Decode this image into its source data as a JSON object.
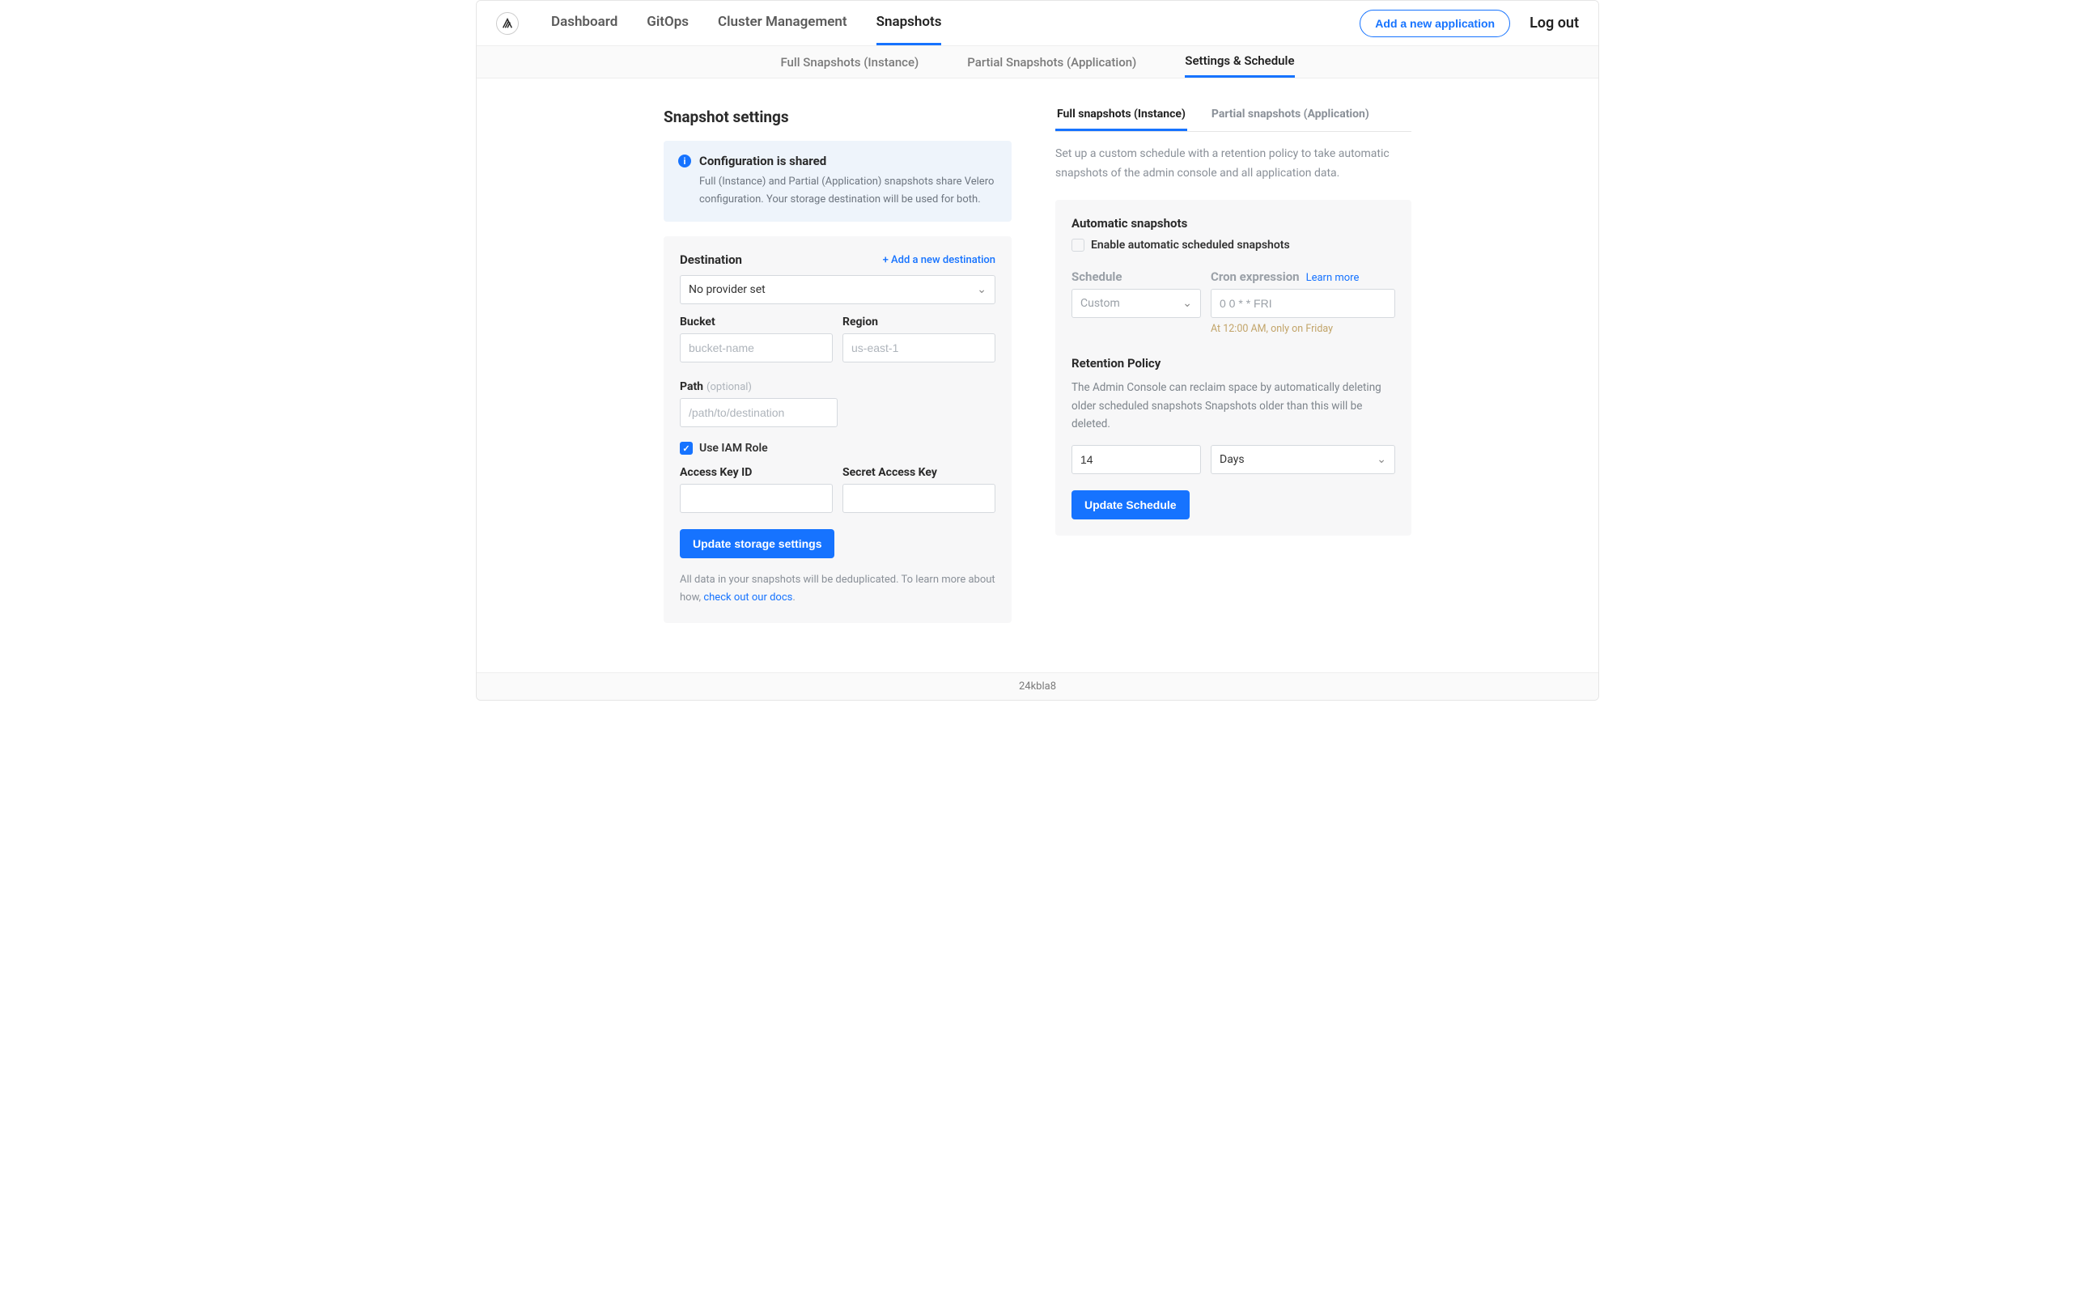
{
  "nav": {
    "items": [
      "Dashboard",
      "GitOps",
      "Cluster Management",
      "Snapshots"
    ],
    "active": 3,
    "add_app": "Add a new application",
    "logout": "Log out"
  },
  "subnav": {
    "items": [
      "Full Snapshots (Instance)",
      "Partial Snapshots (Application)",
      "Settings & Schedule"
    ],
    "active": 2
  },
  "left": {
    "title": "Snapshot settings",
    "info_title": "Configuration is shared",
    "info_body": "Full (Instance) and Partial (Application) snapshots share Velero configuration. Your storage destination will be used for both.",
    "dest_label": "Destination",
    "add_dest": "+ Add a new destination",
    "provider": "No provider set",
    "bucket_label": "Bucket",
    "bucket_ph": "bucket-name",
    "region_label": "Region",
    "region_ph": "us-east-1",
    "path_label": "Path",
    "path_opt": "(optional)",
    "path_ph": "/path/to/destination",
    "iam_label": "Use IAM Role",
    "iam_checked": true,
    "ak_label": "Access Key ID",
    "sk_label": "Secret Access Key",
    "update_btn": "Update storage settings",
    "foot_a": "All data in your snapshots will be deduplicated. To learn more about how, ",
    "foot_link": "check out our docs",
    "foot_b": "."
  },
  "right": {
    "tabs": [
      "Full snapshots (Instance)",
      "Partial snapshots (Application)"
    ],
    "active": 0,
    "desc": "Set up a custom schedule with a retention policy to take automatic snapshots of the admin console and all application data.",
    "auto_title": "Automatic snapshots",
    "auto_check": "Enable automatic scheduled snapshots",
    "auto_checked": false,
    "sched_label": "Schedule",
    "sched_value": "Custom",
    "cron_label": "Cron expression",
    "cron_learn": "Learn more",
    "cron_value": "0 0 * * FRI",
    "cron_hint": "At 12:00 AM, only on Friday",
    "ret_title": "Retention Policy",
    "ret_desc": "The Admin Console can reclaim space by automatically deleting older scheduled snapshots Snapshots older than this will be deleted.",
    "ret_value": "14",
    "ret_unit": "Days",
    "update_btn": "Update Schedule"
  },
  "footer": "24kbla8"
}
